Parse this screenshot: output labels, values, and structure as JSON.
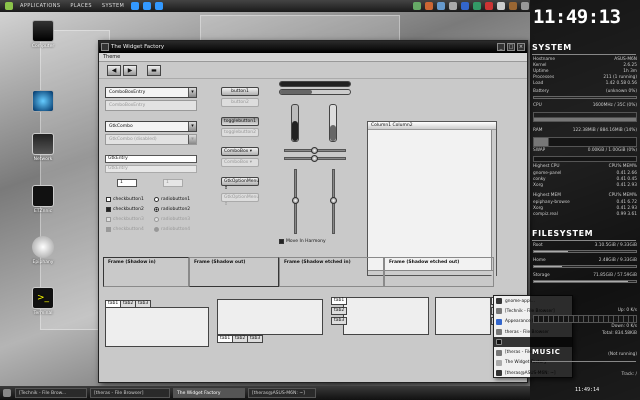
{
  "top_panel": {
    "menus": [
      "APPLICATIONS",
      "PLACES",
      "SYSTEM"
    ]
  },
  "desktop_icons": [
    {
      "label": "Computer",
      "icon": "computer-icon"
    },
    {
      "label": "",
      "icon": "trash-icon"
    },
    {
      "label": "Network",
      "icon": "network-icon"
    },
    {
      "label": "ETZnnic",
      "icon": "terminal-icon"
    },
    {
      "label": "Epiphany",
      "icon": "epiphany-icon"
    },
    {
      "label": "Terminal",
      "icon": "terminal-icon"
    }
  ],
  "window": {
    "title": "The Widget Factory",
    "menu": "Theme",
    "combos": [
      {
        "text": "ComboBoxEntry",
        "disabled": false
      },
      {
        "text": "ComboBoxEntry",
        "disabled": true
      },
      {
        "text": "GtkCombo",
        "disabled": false
      },
      {
        "text": "GtkCombo (disabled)",
        "disabled": true
      }
    ],
    "entries": [
      {
        "text": "GtkEntry",
        "disabled": false
      },
      {
        "text": "GtkEntry",
        "disabled": true
      }
    ],
    "spin_values": [
      "1",
      "1"
    ],
    "checks": [
      {
        "label": "checkbutton1",
        "checked": false,
        "disabled": false
      },
      {
        "label": "checkbutton2",
        "checked": true,
        "disabled": false
      },
      {
        "label": "checkbutton3",
        "checked": false,
        "disabled": true
      },
      {
        "label": "checkbutton4",
        "checked": true,
        "disabled": true
      }
    ],
    "radios": [
      {
        "label": "radiobutton1",
        "checked": false,
        "disabled": false
      },
      {
        "label": "radiobutton2",
        "checked": true,
        "disabled": false
      },
      {
        "label": "radiobutton3",
        "checked": false,
        "disabled": true
      },
      {
        "label": "radiobutton4",
        "checked": true,
        "disabled": true
      }
    ],
    "buttons": [
      {
        "label": "button1",
        "disabled": false
      },
      {
        "label": "button2",
        "disabled": true
      },
      {
        "label": "togglebutton1",
        "disabled": false
      },
      {
        "label": "togglebutton2",
        "disabled": true
      },
      {
        "label": "ComboBox",
        "disabled": false
      },
      {
        "label": "ComboBox",
        "disabled": true
      },
      {
        "label": "GtkOptionMenu",
        "disabled": false
      },
      {
        "label": "GtkOptionMenu",
        "disabled": true
      }
    ],
    "tree_column": "Column1  Column2",
    "move_harmony": "Move In Harmony",
    "frames": [
      "Frame (Shadow in)",
      "Frame (Shadow out)",
      "Frame (Shadow etched in)",
      "Frame (Shadow etched out)"
    ],
    "tabs": [
      "tab1",
      "tab2",
      "tab3"
    ]
  },
  "context_menu": [
    {
      "label": "gnome-appl...",
      "icon": "terminal-icon",
      "selected": false
    },
    {
      "label": "[Technik - File Browser]",
      "icon": "folder-icon",
      "selected": false
    },
    {
      "label": "Appearance Preferences",
      "icon": "appearance-icon",
      "selected": false
    },
    {
      "label": "theras - File Browser",
      "icon": "folder-icon",
      "selected": false
    },
    {
      "label": "",
      "icon": "terminal-icon",
      "selected": true
    },
    {
      "label": "[theras - File Browser]",
      "icon": "folder-icon",
      "selected": false
    },
    {
      "label": "The Widget Factory",
      "icon": "window-icon",
      "selected": false
    },
    {
      "label": "[theras@ASUS-M6N: ~]",
      "icon": "terminal-icon",
      "selected": false
    }
  ],
  "taskbar": [
    {
      "label": "[Technik - File Brow...",
      "active": false
    },
    {
      "label": "[theras - File Browser]",
      "active": false
    },
    {
      "label": "The Widget Factory",
      "active": true
    },
    {
      "label": "[theras@ASUS-M6N: ~]",
      "active": false
    }
  ],
  "tray_time": "11:49:14",
  "sidebar": {
    "clock": "11:49:13",
    "system_title": "SYSTEM",
    "system_rows": [
      {
        "k": "Hostname",
        "v": "ASUS-M6N"
      },
      {
        "k": "Kernel",
        "v": "2.6.25"
      },
      {
        "k": "Uptime",
        "v": "1h 3m"
      },
      {
        "k": "Processes",
        "v": "211 (1 running)"
      },
      {
        "k": "Load",
        "v": "1.42 0.58 0.56"
      }
    ],
    "battery": {
      "k": "Battery",
      "v": "(unknown 0%)"
    },
    "cpu": {
      "k": "CPU",
      "v": "1600MHz / 35C (0%)"
    },
    "ram": {
      "k": "RAM",
      "v": "122.38MiB / 884.16MiB (14%)"
    },
    "swap": {
      "k": "SWAP",
      "v": "0.00KiB / 1.00GiB (0%)"
    },
    "highest_cpu_title": {
      "k": "Highest CPU",
      "v": "CPU% MEM%"
    },
    "highest_cpu_rows": [
      {
        "k": "gnome-panel",
        "v": "0.41 2.66"
      },
      {
        "k": "conky",
        "v": "0.41 0.45"
      },
      {
        "k": "Xorg",
        "v": "0.41 2.93"
      }
    ],
    "highest_mem_title": {
      "k": "Highest MEM",
      "v": "CPU% MEM%"
    },
    "highest_mem_rows": [
      {
        "k": "epiphany-browse",
        "v": "0.41 6.72"
      },
      {
        "k": "Xorg",
        "v": "0.41 2.93"
      },
      {
        "k": "compiz.real",
        "v": "0.99 3.61"
      }
    ],
    "fs_title": "FILESYSTEM",
    "fs_rows": [
      {
        "k": "Root",
        "v": "3.10.5GiB / 9.33GiB",
        "fill": 0.33
      },
      {
        "k": "Home",
        "v": "2.48GiB / 9.33GiB",
        "fill": 0.27
      },
      {
        "k": "Storage",
        "v": "71.85GiB / 57.59GiB",
        "fill": 0.92
      }
    ],
    "net_rows": [
      {
        "k": "",
        "v": "Up: 0 K/s"
      },
      {
        "k": "",
        "v": "Down: 0 K/s"
      },
      {
        "k": "",
        "v": "Total: 834.58KiB"
      }
    ],
    "music_title": "MUSIC",
    "music_status": "(Not running)",
    "track": "Track: /"
  }
}
